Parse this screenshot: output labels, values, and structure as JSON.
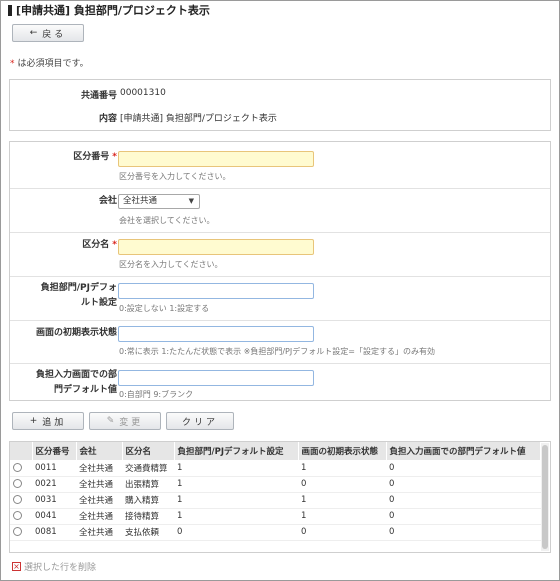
{
  "page": {
    "title": "[申請共通] 負担部門/プロジェクト表示"
  },
  "toolbar": {
    "back_label": "戻る",
    "back_icon": "arrow-left-icon"
  },
  "required_note": {
    "star": "*",
    "text": "は必須項目です。"
  },
  "header": {
    "common_no_label": "共通番号",
    "common_no_value": "00001310",
    "content_label": "内容",
    "content_value": "[申請共通] 負担部門/プロジェクト表示"
  },
  "form": {
    "category_no": {
      "label": "区分番号",
      "required_mark": "*",
      "value": "",
      "hint": "区分番号を入力してください。"
    },
    "company": {
      "label": "会社",
      "selected": "全社共通",
      "hint": "会社を選択してください。"
    },
    "category_name": {
      "label": "区分名",
      "required_mark": "*",
      "value": "",
      "hint": "区分名を入力してください。"
    },
    "dept_default": {
      "label_line1": "負担部門/PJデフォ",
      "label_line2": "ルト設定",
      "value": "",
      "hint": "0:設定しない 1:設定する"
    },
    "initial_display": {
      "label": "画面の初期表示状態",
      "value": "",
      "hint": "0:常に表示 1:たたんだ状態で表示 ※負担部門/PJデフォルト設定=「設定する」のみ有効"
    },
    "input_default": {
      "label_line1": "負担入力画面での部",
      "label_line2": "門デフォルト値",
      "value": "",
      "hint": "0:自部門 9:ブランク"
    }
  },
  "actions": {
    "add_label": "追加",
    "change_label": "変更",
    "clear_label": "クリア"
  },
  "table": {
    "columns": [
      "区分番号",
      "会社",
      "区分名",
      "負担部門/PJデフォルト設定",
      "画面の初期表示状態",
      "負担入力画面での部門デフォルト値"
    ],
    "rows": [
      [
        "0011",
        "全社共通",
        "交通費精算",
        "1",
        "1",
        "0"
      ],
      [
        "0021",
        "全社共通",
        "出張精算",
        "1",
        "0",
        "0"
      ],
      [
        "0031",
        "全社共通",
        "購入精算",
        "1",
        "1",
        "0"
      ],
      [
        "0041",
        "全社共通",
        "接待精算",
        "1",
        "1",
        "0"
      ],
      [
        "0081",
        "全社共通",
        "支払依頼",
        "0",
        "0",
        "0"
      ]
    ]
  },
  "footer": {
    "delete_label": "選択した行を削除"
  },
  "colors": {
    "required": "#d9241c",
    "required_bg": "#fffbd0",
    "input_border_blue": "#93b7e1"
  }
}
